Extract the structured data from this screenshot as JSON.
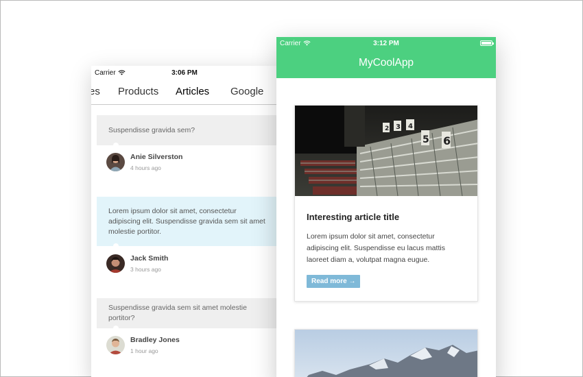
{
  "back_phone": {
    "status": {
      "carrier": "Carrier",
      "time": "3:06 PM"
    },
    "tabs": [
      {
        "label": "es"
      },
      {
        "label": "Products"
      },
      {
        "label": "Articles",
        "active": true
      },
      {
        "label": "Google"
      }
    ],
    "posts": [
      {
        "question": "Suspendisse gravida sem?",
        "author": "Anie Silverston",
        "ago": "4 hours ago",
        "highlight": false
      },
      {
        "question": "Lorem ipsum dolor sit amet, consectetur adipiscing elit. Suspendisse gravida sem sit amet molestie portitor.",
        "author": "Jack Smith",
        "ago": "3 hours ago",
        "highlight": true
      },
      {
        "question": "Suspendisse gravida sem sit amet molestie portitor?",
        "author": "Bradley Jones",
        "ago": "1 hour ago",
        "highlight": false
      }
    ]
  },
  "front_phone": {
    "status": {
      "carrier": "Carrier",
      "time": "3:12 PM"
    },
    "app_title": "MyCoolApp",
    "header_color": "#4cd080",
    "card": {
      "title": "Interesting article title",
      "body": "Lorem ipsum dolor sit amet, consectetur adipiscing elit. Suspendisse eu lacus mattis laoreet diam a, volutpat magna eugue.",
      "read_more": "Read more →"
    }
  },
  "colors": {
    "accent": "#4cd080",
    "button": "#7fb9d8",
    "highlight": "#e2f4fa"
  }
}
